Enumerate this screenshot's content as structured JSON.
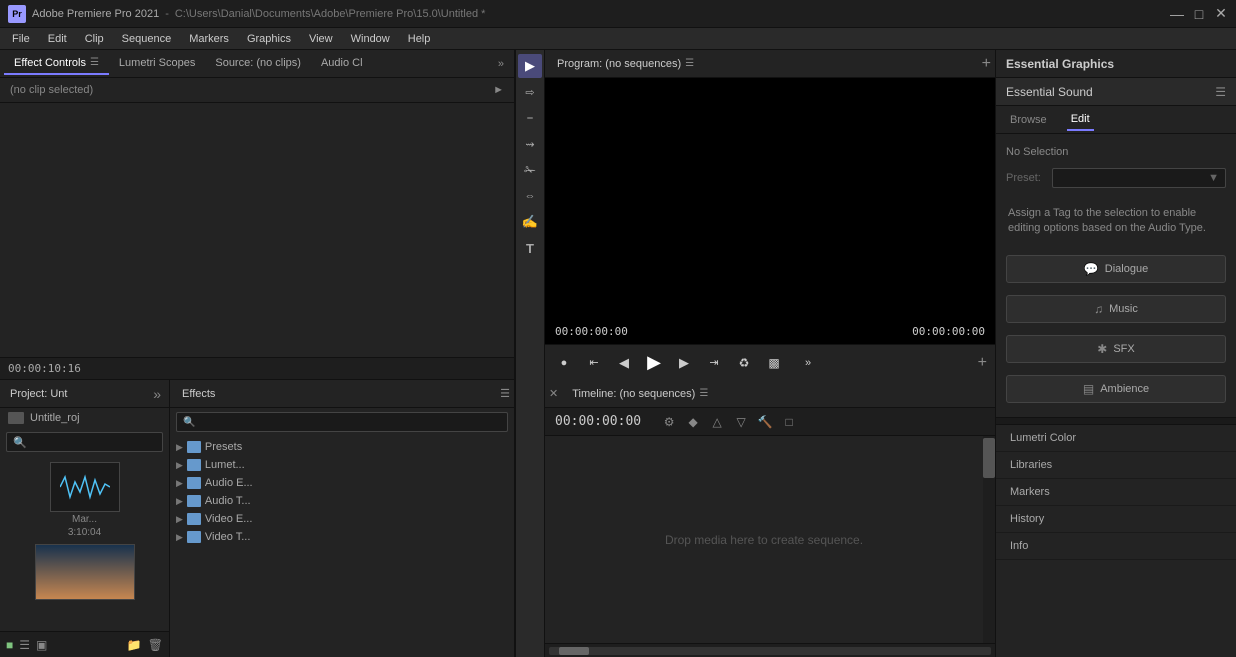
{
  "titleBar": {
    "appName": "Adobe Premiere Pro 2021",
    "filePath": "C:\\Users\\Danial\\Documents\\Adobe\\Premiere Pro\\15.0\\Untitled *",
    "appIconText": "Pr"
  },
  "menuBar": {
    "items": [
      "File",
      "Edit",
      "Clip",
      "Sequence",
      "Markers",
      "Graphics",
      "View",
      "Window",
      "Help"
    ]
  },
  "effectControls": {
    "tabLabel": "Effect Controls",
    "noClipText": "(no clip selected)",
    "timestamp": "00:00:10:16"
  },
  "lumetriScopes": {
    "tabLabel": "Lumetri Scopes"
  },
  "sourcePanel": {
    "tabLabel": "Source: (no clips)"
  },
  "audioClip": {
    "tabLabel": "Audio Cl"
  },
  "programMonitor": {
    "tabLabel": "Program: (no sequences)",
    "timecodeLeft": "00:00:00:00",
    "timecodeRight": "00:00:00:00"
  },
  "projectPanel": {
    "tabLabel": "Project: Unt",
    "fileName": "Untitle_roj",
    "audioLabel": "Mar...",
    "audioDuration": "3:10:04"
  },
  "effectsPanel": {
    "tabLabel": "Effects",
    "searchPlaceholder": "",
    "treeItems": [
      {
        "label": "Presets"
      },
      {
        "label": "Lumet..."
      },
      {
        "label": "Audio E..."
      },
      {
        "label": "Audio T..."
      },
      {
        "label": "Video E..."
      },
      {
        "label": "Video T..."
      }
    ]
  },
  "timeline": {
    "tabLabel": "Timeline: (no sequences)",
    "timecode": "00:00:00:00",
    "dropText": "Drop media here to create sequence."
  },
  "essentialGraphics": {
    "headerLabel": "Essential Graphics",
    "essentialSoundLabel": "Essential Sound",
    "browseTab": "Browse",
    "editTab": "Edit",
    "noSelectionText": "No Selection",
    "presetLabel": "Preset:",
    "assignTagText": "Assign a Tag to the selection to enable editing options based on the Audio Type.",
    "dialogueBtn": "Dialogue",
    "musicBtn": "Music",
    "sfxBtn": "SFX",
    "ambienceBtn": "Ambience",
    "rightPanelItems": [
      "Lumetri Color",
      "Libraries",
      "Markers",
      "History",
      "Info"
    ]
  },
  "tools": {
    "items": [
      "▶",
      "⊹",
      "⊞",
      "⟺",
      "✏",
      "✋",
      "T"
    ]
  }
}
